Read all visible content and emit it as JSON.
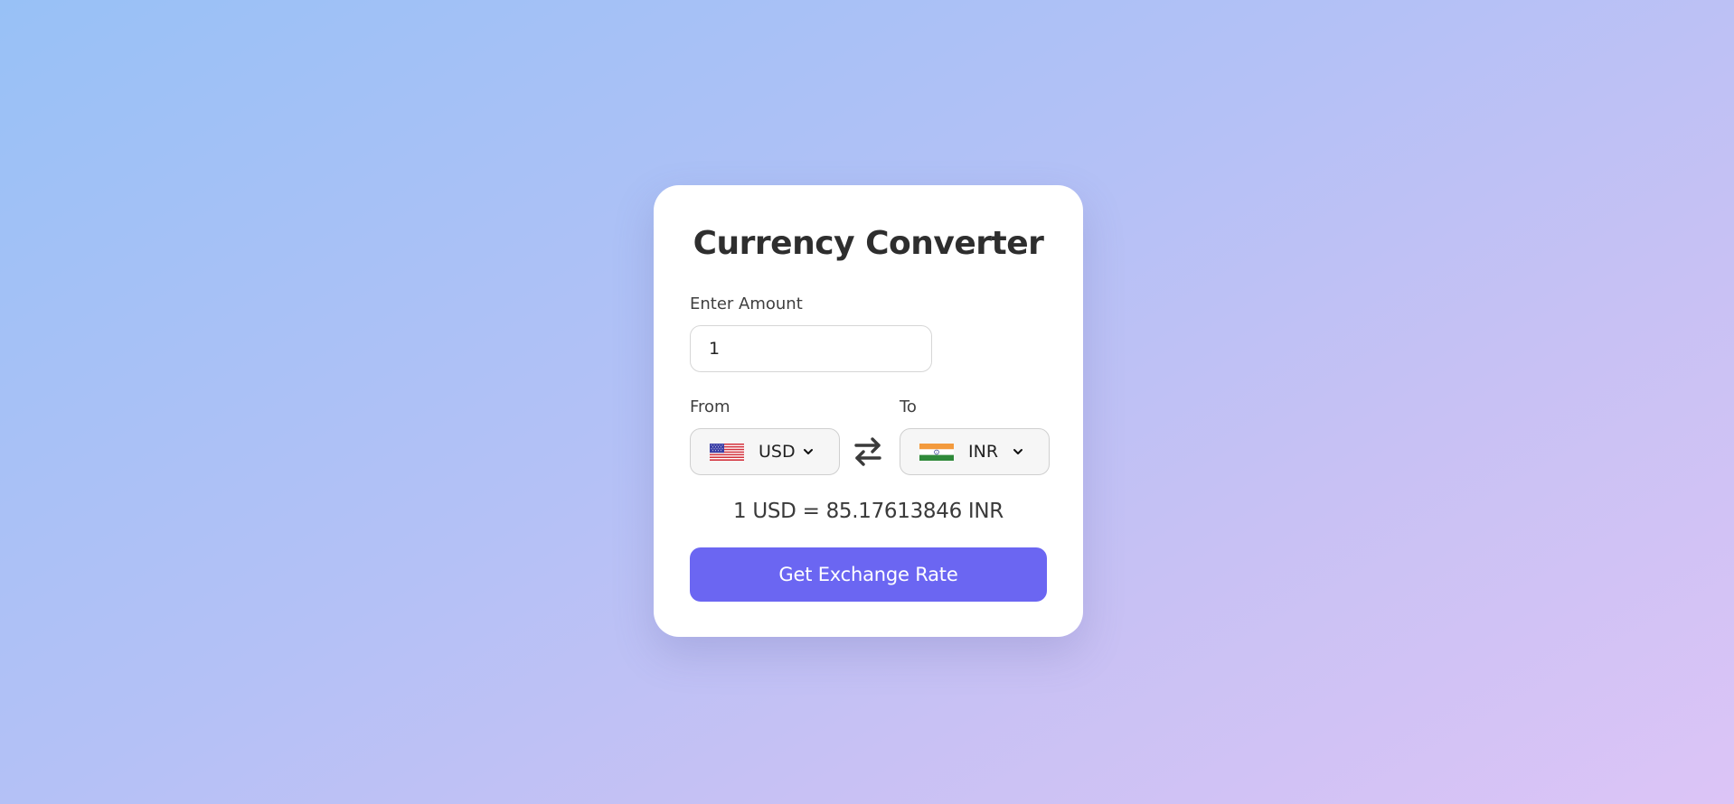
{
  "title": "Currency Converter",
  "amount": {
    "label": "Enter Amount",
    "value": "1"
  },
  "from": {
    "label": "From",
    "currency": "USD",
    "flag_icon": "us-flag-icon"
  },
  "to": {
    "label": "To",
    "currency": "INR",
    "flag_icon": "india-flag-icon"
  },
  "swap_icon": "swap-arrows-icon",
  "result_text": "1 USD = 85.17613846 INR",
  "button_label": "Get Exchange Rate",
  "colors": {
    "accent": "#6b66f2",
    "background_start": "#98c1f6",
    "background_end": "#dcc4f6",
    "card": "#ffffff"
  }
}
